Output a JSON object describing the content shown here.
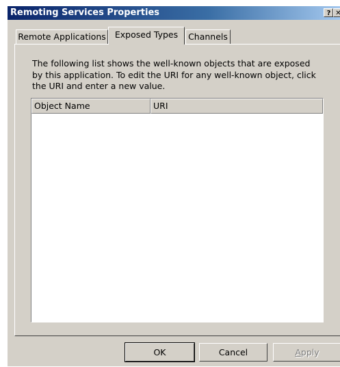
{
  "window": {
    "title": "Remoting Services Properties",
    "help_glyph": "?",
    "close_glyph": "✕"
  },
  "tabs": [
    {
      "label": "Remote Applications",
      "active": false
    },
    {
      "label": "Exposed Types",
      "active": true
    },
    {
      "label": "Channels",
      "active": false
    }
  ],
  "description": {
    "line1": "The following list shows the well-known objects that are exposed",
    "line2": "by this application. To edit the URI for any well-known object, click",
    "line3": "the URI and enter a new value."
  },
  "list": {
    "columns": [
      "Object Name",
      "URI"
    ],
    "rows": []
  },
  "buttons": {
    "ok": "OK",
    "cancel": "Cancel",
    "apply": "Apply"
  },
  "colors": {
    "title_start": "#0a246a",
    "title_end": "#a6caf0",
    "face": "#d4d0c8"
  }
}
